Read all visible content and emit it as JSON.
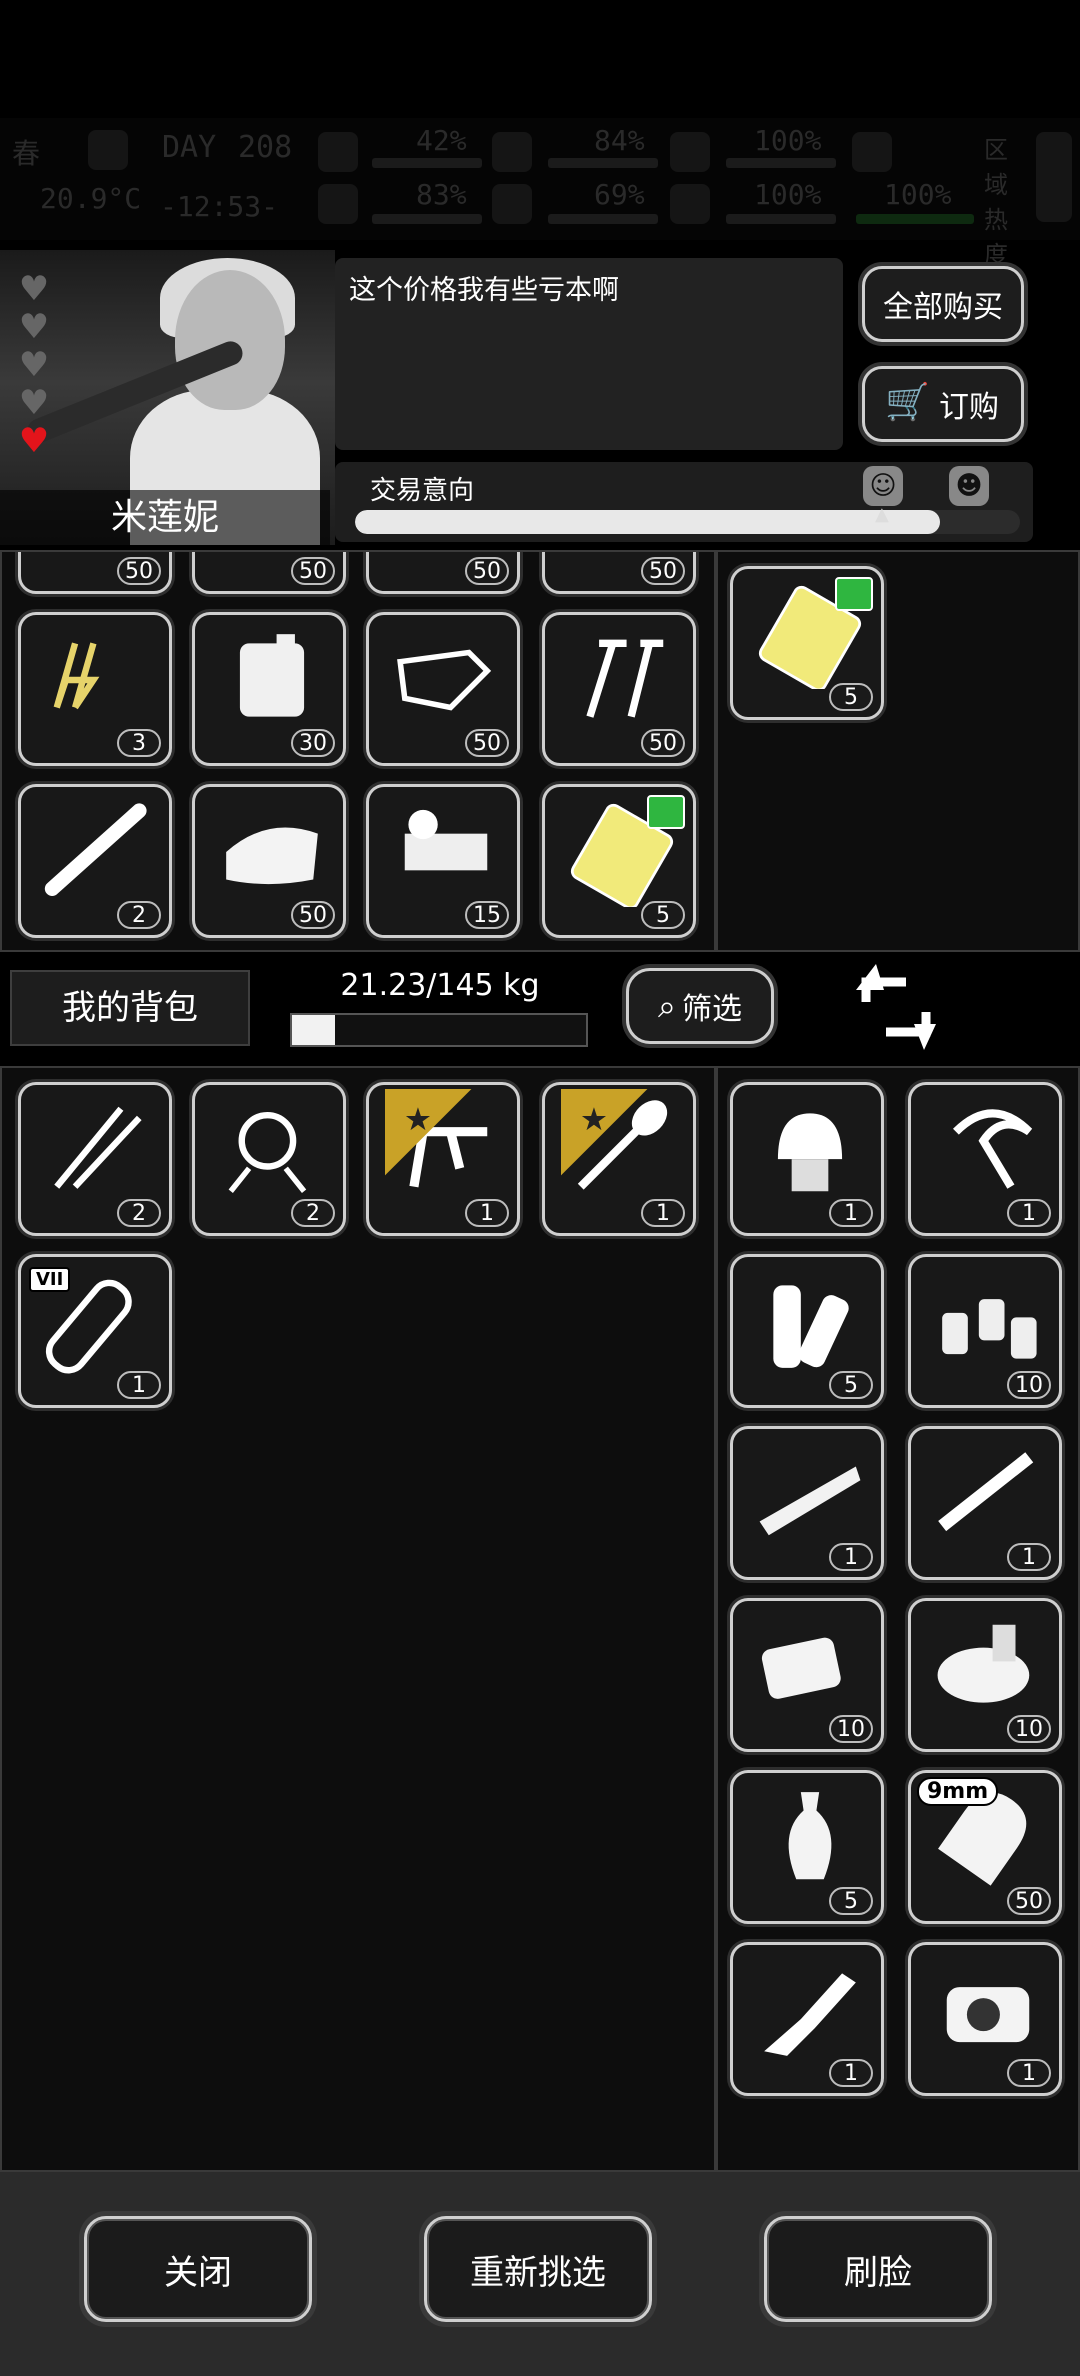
{
  "hud": {
    "season": "春",
    "day_label": "DAY",
    "day": "208",
    "temperature": "20.9°C",
    "time": "-12:53-",
    "stats_top": [
      "42%",
      "84%",
      "100%"
    ],
    "stats_bottom": [
      "83%",
      "69%",
      "100%",
      "100%"
    ],
    "zone_label": "区域热度"
  },
  "npc": {
    "name": "米莲妮",
    "dialog": "这个价格我有些亏本啊",
    "hearts_total": 5,
    "hearts_filled": 1
  },
  "actions": {
    "buy_all": "全部购买",
    "order": "订购"
  },
  "intent": {
    "label": "交易意向",
    "level": 0.88
  },
  "merchant_items": [
    {
      "count": "50"
    },
    {
      "count": "50"
    },
    {
      "count": "50"
    },
    {
      "count": "50"
    },
    {
      "count": "3",
      "icon": "tongs-icon"
    },
    {
      "count": "30",
      "icon": "jerrycan-icon"
    },
    {
      "count": "50",
      "icon": "metal-scrap-icon"
    },
    {
      "count": "50",
      "icon": "screws-icon"
    },
    {
      "count": "2",
      "icon": "pipe-icon"
    },
    {
      "count": "50",
      "icon": "cloth-icon"
    },
    {
      "count": "15",
      "icon": "tape-roll-icon"
    },
    {
      "count": "5",
      "icon": "gold-card-icon"
    }
  ],
  "merchant_side_items": [
    {
      "count": "5",
      "icon": "gold-card-icon"
    }
  ],
  "bag": {
    "label": "我的背包",
    "weight": "21.23/145 kg",
    "weight_level": 0.146,
    "filter": "筛选"
  },
  "bag_items": [
    {
      "count": "2",
      "icon": "picks-icon"
    },
    {
      "count": "2",
      "icon": "rope-icon"
    },
    {
      "count": "1",
      "icon": "caliper-icon",
      "starred": true
    },
    {
      "count": "1",
      "icon": "shovel-icon",
      "starred": true
    },
    {
      "count": "1",
      "icon": "test-tube-icon",
      "tag": "VII"
    }
  ],
  "trade_items": [
    {
      "count": "1",
      "icon": "helmet-icon"
    },
    {
      "count": "1",
      "icon": "sickle-icon"
    },
    {
      "count": "5",
      "icon": "logs-icon"
    },
    {
      "count": "10",
      "icon": "bottles-icon"
    },
    {
      "count": "1",
      "icon": "wood-plank-icon"
    },
    {
      "count": "1",
      "icon": "rifle-part-icon"
    },
    {
      "count": "10",
      "icon": "bread-icon"
    },
    {
      "count": "10",
      "icon": "canned-fish-icon"
    },
    {
      "count": "5",
      "icon": "vase-icon"
    },
    {
      "count": "50",
      "icon": "bullet-icon",
      "tag": "9mm"
    },
    {
      "count": "1",
      "icon": "smg-icon"
    },
    {
      "count": "1",
      "icon": "gear-part-icon"
    }
  ],
  "footer": {
    "close": "关闭",
    "reselect": "重新挑选",
    "face_scan": "刷脸"
  }
}
